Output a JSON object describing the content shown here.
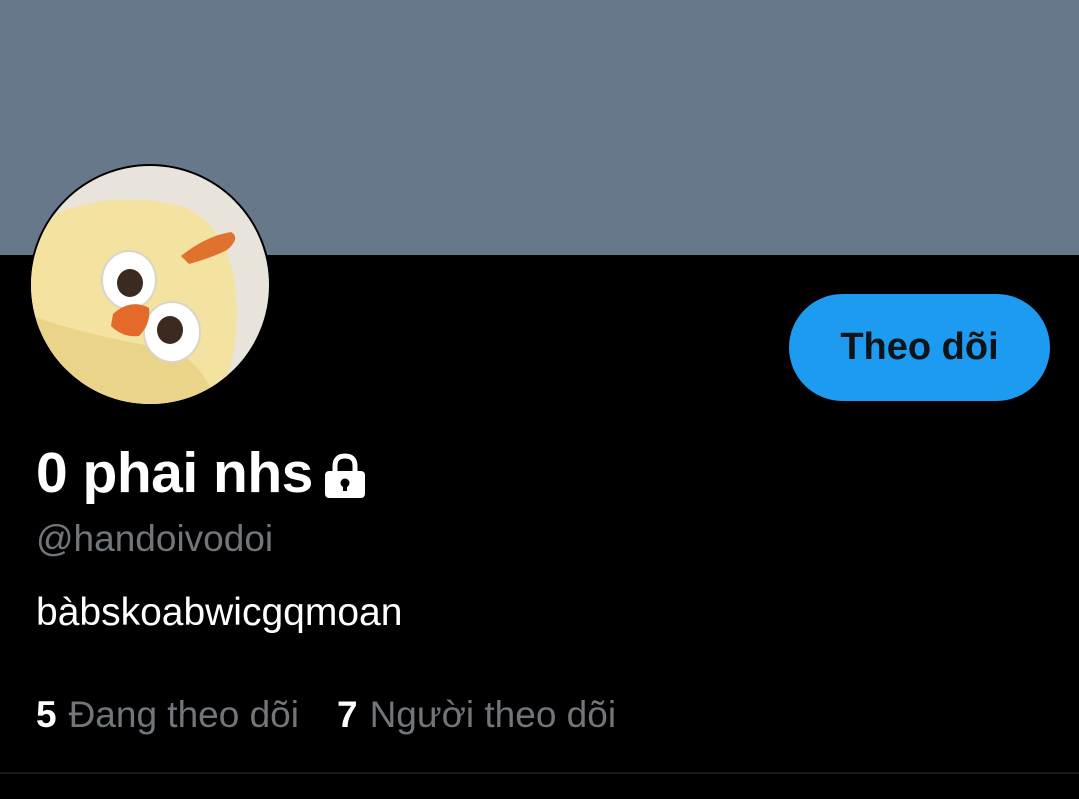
{
  "profile": {
    "display_name": "0 phai nhs",
    "handle": "@handoivodoi",
    "bio": "bàbskoabwicgqmoan",
    "locked_icon": "lock-icon",
    "avatar_icon": "chick-avatar"
  },
  "actions": {
    "follow_label": "Theo dõi"
  },
  "stats": {
    "following_count": "5",
    "following_label": "Đang theo dõi",
    "followers_count": "7",
    "followers_label": "Người theo dõi"
  },
  "colors": {
    "banner": "#66788a",
    "background": "#000000",
    "accent": "#1d9bf0",
    "secondary_text": "#71767b"
  }
}
